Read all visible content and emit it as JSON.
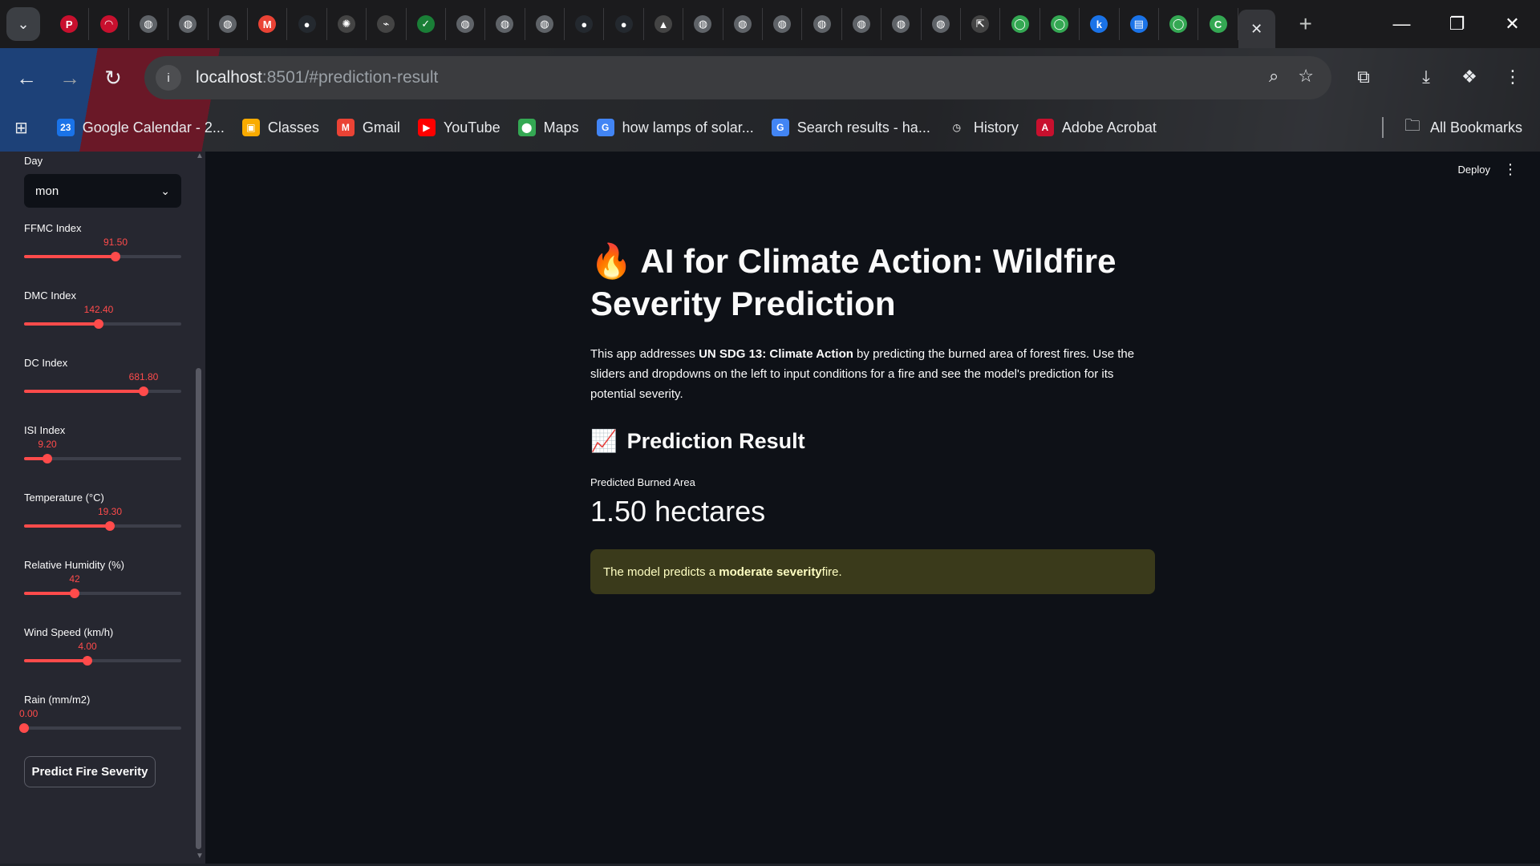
{
  "browser": {
    "tabs": [
      {
        "icon": "pdf-icon",
        "color": "#c8102e",
        "glyph": "P"
      },
      {
        "icon": "speedometer-icon",
        "color": "#c8102e",
        "glyph": "◠"
      },
      {
        "icon": "globe-icon",
        "color": "#5f6368",
        "glyph": "◍"
      },
      {
        "icon": "globe-icon",
        "color": "#5f6368",
        "glyph": "◍"
      },
      {
        "icon": "globe-icon",
        "color": "#5f6368",
        "glyph": "◍"
      },
      {
        "icon": "gmail-icon",
        "color": "#ea4335",
        "glyph": "M"
      },
      {
        "icon": "github-icon",
        "color": "#24292f",
        "glyph": "●"
      },
      {
        "icon": "openai-icon",
        "color": "#444",
        "glyph": "✺"
      },
      {
        "icon": "link-icon",
        "color": "#444",
        "glyph": "⌁"
      },
      {
        "icon": "link-check-icon",
        "color": "#1a7f37",
        "glyph": "✓"
      },
      {
        "icon": "globe-icon",
        "color": "#5f6368",
        "glyph": "◍"
      },
      {
        "icon": "globe-icon",
        "color": "#5f6368",
        "glyph": "◍"
      },
      {
        "icon": "globe-icon",
        "color": "#5f6368",
        "glyph": "◍"
      },
      {
        "icon": "github-icon",
        "color": "#24292f",
        "glyph": "●"
      },
      {
        "icon": "github-icon",
        "color": "#24292f",
        "glyph": "●"
      },
      {
        "icon": "triangle-icon",
        "color": "#444",
        "glyph": "▲"
      },
      {
        "icon": "globe-icon",
        "color": "#5f6368",
        "glyph": "◍"
      },
      {
        "icon": "globe-icon",
        "color": "#5f6368",
        "glyph": "◍"
      },
      {
        "icon": "globe-icon",
        "color": "#5f6368",
        "glyph": "◍"
      },
      {
        "icon": "globe-icon",
        "color": "#5f6368",
        "glyph": "◍"
      },
      {
        "icon": "globe-icon",
        "color": "#5f6368",
        "glyph": "◍"
      },
      {
        "icon": "globe-icon",
        "color": "#5f6368",
        "glyph": "◍"
      },
      {
        "icon": "globe-icon",
        "color": "#5f6368",
        "glyph": "◍"
      },
      {
        "icon": "share-icon",
        "color": "#444",
        "glyph": "⇱"
      },
      {
        "icon": "loading-ring-icon",
        "color": "#34a853",
        "glyph": "◯"
      },
      {
        "icon": "loading-ring-icon",
        "color": "#34a853",
        "glyph": "◯"
      },
      {
        "icon": "k-icon",
        "color": "#1a73e8",
        "glyph": "k"
      },
      {
        "icon": "database-icon",
        "color": "#1a73e8",
        "glyph": "▤"
      },
      {
        "icon": "loading-ring-icon",
        "color": "#34a853",
        "glyph": "◯"
      },
      {
        "icon": "c-icon",
        "color": "#34a853",
        "glyph": "C"
      }
    ],
    "url_host": "localhost",
    "url_rest": ":8501/#prediction-result",
    "bookmarks": [
      {
        "label": "Google Calendar - 2...",
        "icon": "calendar-icon",
        "color": "#1a73e8",
        "glyph": "23"
      },
      {
        "label": "Classes",
        "icon": "classroom-icon",
        "color": "#f9ab00",
        "glyph": "▣"
      },
      {
        "label": "Gmail",
        "icon": "gmail-icon",
        "color": "#ea4335",
        "glyph": "M"
      },
      {
        "label": "YouTube",
        "icon": "youtube-icon",
        "color": "#ff0000",
        "glyph": "▶"
      },
      {
        "label": "Maps",
        "icon": "maps-icon",
        "color": "#34a853",
        "glyph": "⬤"
      },
      {
        "label": "how lamps of solar...",
        "icon": "google-icon",
        "color": "#4285f4",
        "glyph": "G"
      },
      {
        "label": "Search results - ha...",
        "icon": "google-icon",
        "color": "#4285f4",
        "glyph": "G"
      },
      {
        "label": "History",
        "icon": "history-icon",
        "color": "transparent",
        "glyph": "◷"
      },
      {
        "label": "Adobe Acrobat",
        "icon": "acrobat-icon",
        "color": "#c8102e",
        "glyph": "A"
      }
    ],
    "all_bookmarks": "All Bookmarks"
  },
  "sidebar": {
    "day_label": "Day",
    "day_value": "mon",
    "sliders": [
      {
        "label": "FFMC Index",
        "value": "91.50",
        "fraction": 0.58
      },
      {
        "label": "DMC Index",
        "value": "142.40",
        "fraction": 0.475
      },
      {
        "label": "DC Index",
        "value": "681.80",
        "fraction": 0.76
      },
      {
        "label": "ISI Index",
        "value": "9.20",
        "fraction": 0.15
      },
      {
        "label": "Temperature (°C)",
        "value": "19.30",
        "fraction": 0.545
      },
      {
        "label": "Relative Humidity (%)",
        "value": "42",
        "fraction": 0.32
      },
      {
        "label": "Wind Speed (km/h)",
        "value": "4.00",
        "fraction": 0.405
      },
      {
        "label": "Rain (mm/m2)",
        "value": "0.00",
        "fraction": 0.0
      }
    ],
    "predict_button": "Predict Fire Severity"
  },
  "header": {
    "deploy": "Deploy"
  },
  "main": {
    "title_emoji": "🔥",
    "title": "AI for Climate Action: Wildfire Severity Prediction",
    "desc_pre": "This app addresses ",
    "desc_bold": "UN SDG 13: Climate Action",
    "desc_post": " by predicting the burned area of forest fires. Use the sliders and dropdowns on the left to input conditions for a fire and see the model's prediction for its potential severity.",
    "subhead_emoji": "📈",
    "subhead": "Prediction Result",
    "metric_label": "Predicted Burned Area",
    "metric_value": "1.50 hectares",
    "alert_pre": "The model predicts a ",
    "alert_bold": "moderate severity",
    "alert_post": " fire."
  }
}
